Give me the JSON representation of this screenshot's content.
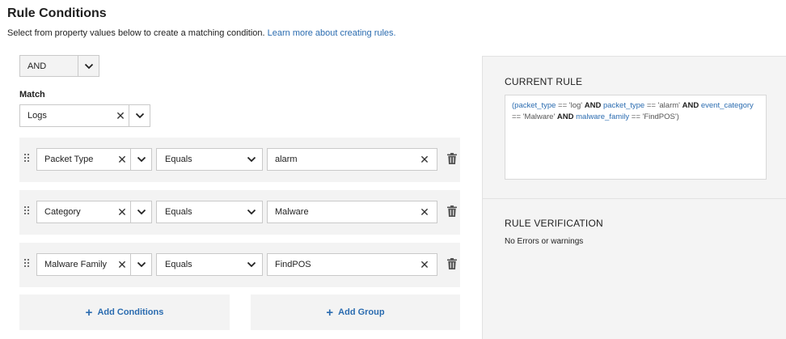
{
  "header": {
    "title": "Rule Conditions",
    "subtitle": "Select from property values below to create a matching condition.",
    "learn_more_link": "Learn more about creating rules."
  },
  "logic_operator": {
    "value": "AND"
  },
  "match": {
    "label": "Match",
    "value": "Logs"
  },
  "conditions": [
    {
      "property": "Packet Type",
      "operator": "Equals",
      "value": "alarm"
    },
    {
      "property": "Category",
      "operator": "Equals",
      "value": "Malware"
    },
    {
      "property": "Malware Family",
      "operator": "Equals",
      "value": "FindPOS"
    }
  ],
  "buttons": {
    "add_conditions": "Add Conditions",
    "add_group": "Add Group"
  },
  "current_rule": {
    "title": "CURRENT RULE",
    "tokens": [
      {
        "t": "(",
        "c": "k"
      },
      {
        "t": "packet_type",
        "c": "k"
      },
      {
        "t": " == 'log' ",
        "c": "s"
      },
      {
        "t": "AND",
        "c": "op"
      },
      {
        "t": " ",
        "c": "s"
      },
      {
        "t": "packet_type",
        "c": "k"
      },
      {
        "t": " == 'alarm' ",
        "c": "s"
      },
      {
        "t": "AND",
        "c": "op"
      },
      {
        "t": " ",
        "c": "s"
      },
      {
        "t": "event_category",
        "c": "k"
      },
      {
        "t": " == 'Malware' ",
        "c": "s"
      },
      {
        "t": "AND",
        "c": "op"
      },
      {
        "t": " ",
        "c": "s"
      },
      {
        "t": "malware_family",
        "c": "k"
      },
      {
        "t": " == 'FindPOS')",
        "c": "s"
      }
    ]
  },
  "rule_verification": {
    "title": "RULE VERIFICATION",
    "message": "No Errors or warnings"
  },
  "icons": {
    "clear": "close-icon",
    "dropdown": "chevron-down-icon",
    "drag": "drag-handle-icon",
    "delete": "trash-icon",
    "add": "plus-icon"
  },
  "colors": {
    "link": "#2b6cb0",
    "panel_bg": "#f4f4f4",
    "row_bg": "#f3f3f3"
  }
}
